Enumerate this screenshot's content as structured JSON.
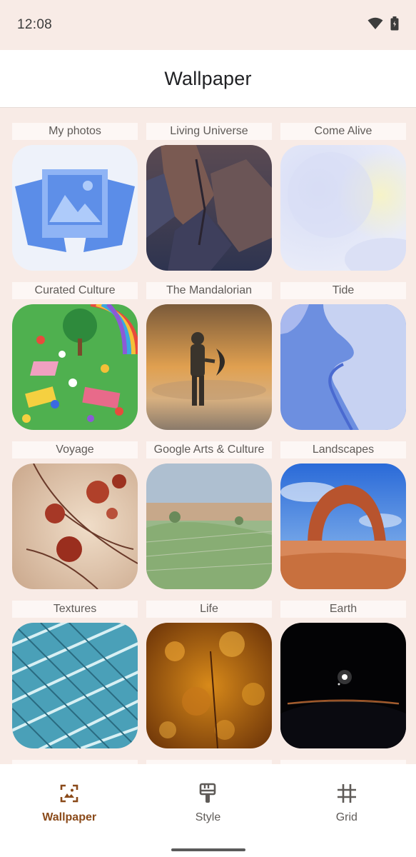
{
  "status_bar": {
    "time": "12:08",
    "icons": [
      "wifi-icon",
      "battery-icon"
    ]
  },
  "app_bar": {
    "title": "Wallpaper"
  },
  "categories": [
    {
      "label": "My photos"
    },
    {
      "label": "Living Universe"
    },
    {
      "label": "Come Alive"
    },
    {
      "label": "Curated Culture"
    },
    {
      "label": "The Mandalorian"
    },
    {
      "label": "Tide"
    },
    {
      "label": "Voyage"
    },
    {
      "label": "Google Arts & Culture"
    },
    {
      "label": "Landscapes"
    },
    {
      "label": "Textures"
    },
    {
      "label": "Life"
    },
    {
      "label": "Earth"
    }
  ],
  "bottom_nav": {
    "items": [
      {
        "label": "Wallpaper",
        "icon": "wallpaper-icon",
        "active": true
      },
      {
        "label": "Style",
        "icon": "brush-icon",
        "active": false
      },
      {
        "label": "Grid",
        "icon": "grid-icon",
        "active": false
      }
    ]
  },
  "colors": {
    "accent": "#8a4a1a",
    "background": "#f8ebe6",
    "surface": "#ffffff"
  }
}
